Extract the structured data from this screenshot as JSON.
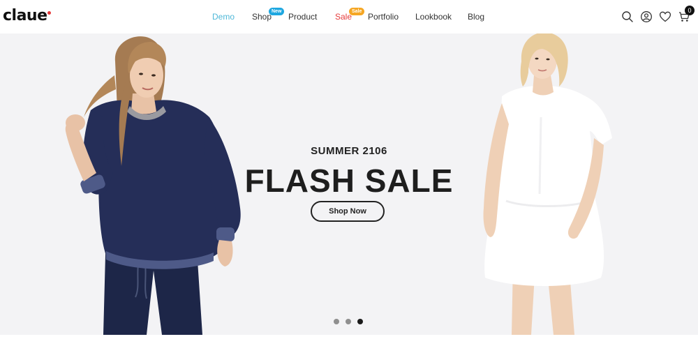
{
  "brand": {
    "logo_text": "claue",
    "accent_color": "#e53b3b"
  },
  "nav": {
    "items": [
      {
        "label": "Demo",
        "state": "active"
      },
      {
        "label": "Shop",
        "badge": "New"
      },
      {
        "label": "Product"
      },
      {
        "label": "Sale",
        "badge": "Sale"
      },
      {
        "label": "Portfolio"
      },
      {
        "label": "Lookbook"
      },
      {
        "label": "Blog"
      }
    ]
  },
  "header_icons": {
    "search": "search-icon",
    "account": "user-icon",
    "wishlist": "heart-icon",
    "cart": "cart-icon",
    "cart_count": "0"
  },
  "hero": {
    "subtitle": "SUMMER 2106",
    "title": "FLASH SALE",
    "cta_label": "Shop Now",
    "slides_total": 3,
    "active_slide": 3
  },
  "colors": {
    "nav_active": "#4fb8d8",
    "badge_new": "#1ea7e0",
    "badge_sale": "#f5a623",
    "hero_background": "#f3f3f5"
  }
}
